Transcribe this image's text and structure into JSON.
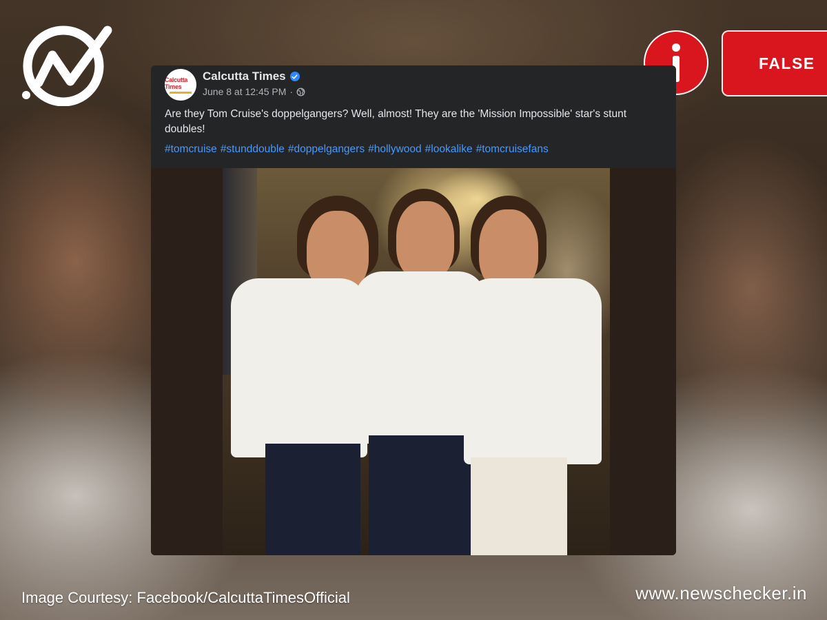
{
  "badge": {
    "label": "FALSE",
    "color": "#d9161d"
  },
  "icons": {
    "logo": "newschecker-check-logo",
    "info": "info-icon",
    "verified": "verified-badge-icon",
    "globe": "globe-icon"
  },
  "post": {
    "page_name": "Calcutta Times",
    "avatar_text": "Calcutta Times",
    "timestamp": "June 8 at 12:45 PM",
    "separator": "·",
    "text": "Are they Tom Cruise's doppelgangers? Well, almost! They are the 'Mission Impossible' star's stunt doubles!",
    "hashtags": [
      "#tomcruise",
      "#stunddouble",
      "#doppelgangers",
      "#hollywood",
      "#lookalike",
      "#tomcruisefans"
    ]
  },
  "footer": {
    "credit": "Image Courtesy: Facebook/CalcuttaTimesOfficial",
    "site": "www.newschecker.in"
  }
}
